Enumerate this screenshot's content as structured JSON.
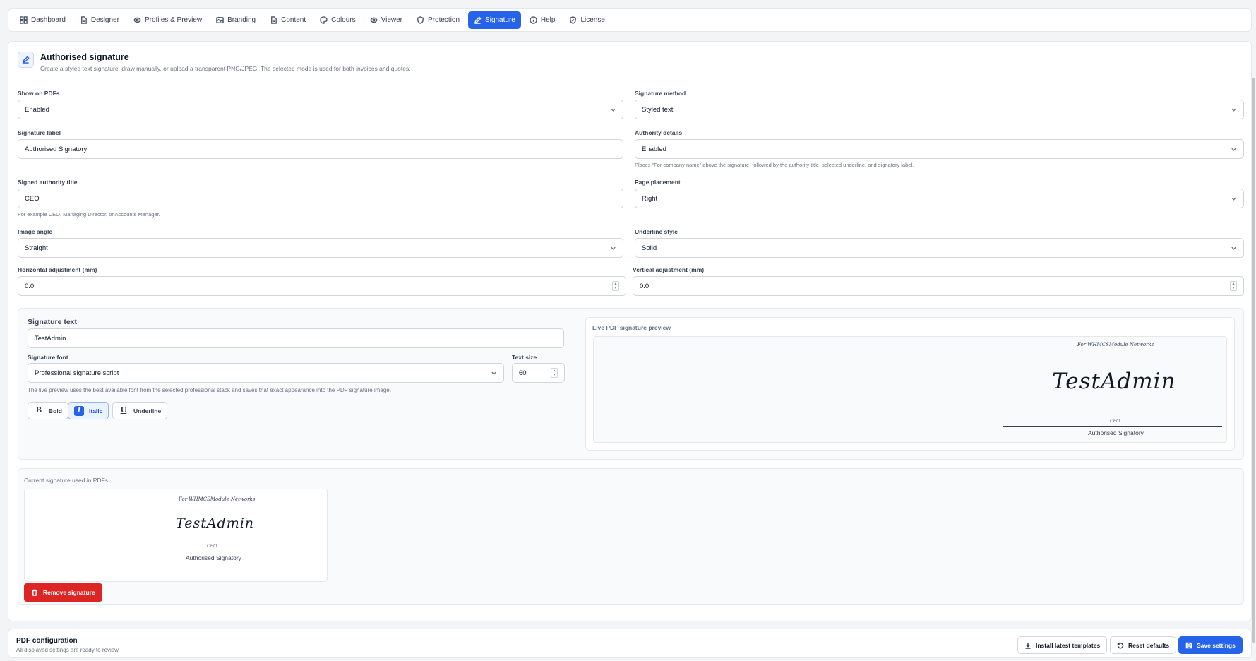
{
  "nav": {
    "tabs": [
      {
        "label": "Dashboard",
        "icon": "grid-icon"
      },
      {
        "label": "Designer",
        "icon": "document-icon"
      },
      {
        "label": "Profiles & Preview",
        "icon": "eye-icon"
      },
      {
        "label": "Branding",
        "icon": "image-icon"
      },
      {
        "label": "Content",
        "icon": "file-text-icon"
      },
      {
        "label": "Colours",
        "icon": "palette-icon"
      },
      {
        "label": "Viewer",
        "icon": "eye-icon"
      },
      {
        "label": "Protection",
        "icon": "shield-icon"
      },
      {
        "label": "Signature",
        "icon": "pen-icon",
        "active": true
      },
      {
        "label": "Help",
        "icon": "info-icon"
      },
      {
        "label": "License",
        "icon": "shield-check-icon"
      }
    ]
  },
  "section": {
    "title": "Authorised signature",
    "description": "Create a styled text signature, draw manually, or upload a transparent PNG/JPEG. The selected mode is used for both invoices and quotes."
  },
  "fields": {
    "show_on_pdfs": {
      "label": "Show on PDFs",
      "value": "Enabled"
    },
    "signature_method": {
      "label": "Signature method",
      "value": "Styled text"
    },
    "signature_label": {
      "label": "Signature label",
      "value": "Authorised Signatory"
    },
    "authority_details": {
      "label": "Authority details",
      "value": "Enabled",
      "help": "Places “For company name” above the signature, followed by the authority title, selected underline, and signatory label."
    },
    "signed_authority_title": {
      "label": "Signed authority title",
      "value": "CEO",
      "help": "For example CEO, Managing Director, or Accounts Manager."
    },
    "page_placement": {
      "label": "Page placement",
      "value": "Right"
    },
    "image_angle": {
      "label": "Image angle",
      "value": "Straight"
    },
    "underline_style": {
      "label": "Underline style",
      "value": "Solid"
    },
    "horizontal_adjustment": {
      "label": "Horizontal adjustment (mm)",
      "value": "0.0"
    },
    "vertical_adjustment": {
      "label": "Vertical adjustment (mm)",
      "value": "0.0"
    }
  },
  "signature_text_panel": {
    "title": "Signature text",
    "text_value": "TestAdmin",
    "font_label": "Signature font",
    "font_value": "Professional signature script",
    "size_label": "Text size",
    "size_value": "60",
    "help": "The live preview uses the best available font from the selected professional stack and saves that exact appearance into the PDF signature image.",
    "format_buttons": [
      {
        "label": "Bold",
        "glyph": "B",
        "active": false
      },
      {
        "label": "Italic",
        "glyph": "I",
        "active": true
      },
      {
        "label": "Underline",
        "glyph": "U",
        "active": false
      }
    ]
  },
  "live_preview": {
    "title": "Live PDF signature preview",
    "for_company": "For WHMCSModule Networks",
    "signature": "TestAdmin",
    "authority": "CEO",
    "signatory": "Authorised Signatory"
  },
  "current_signature": {
    "title": "Current signature used in PDFs",
    "for_company": "For WHMCSModule Networks",
    "signature": "TestAdmin",
    "authority": "CEO",
    "signatory": "Authorised Signatory",
    "remove_label": "Remove signature"
  },
  "footer": {
    "title": "PDF configuration",
    "subtitle": "All displayed settings are ready to review.",
    "install_label": "Install latest templates",
    "reset_label": "Reset defaults",
    "save_label": "Save settings"
  },
  "colors": {
    "accent": "#2563eb",
    "danger": "#dc2626"
  }
}
